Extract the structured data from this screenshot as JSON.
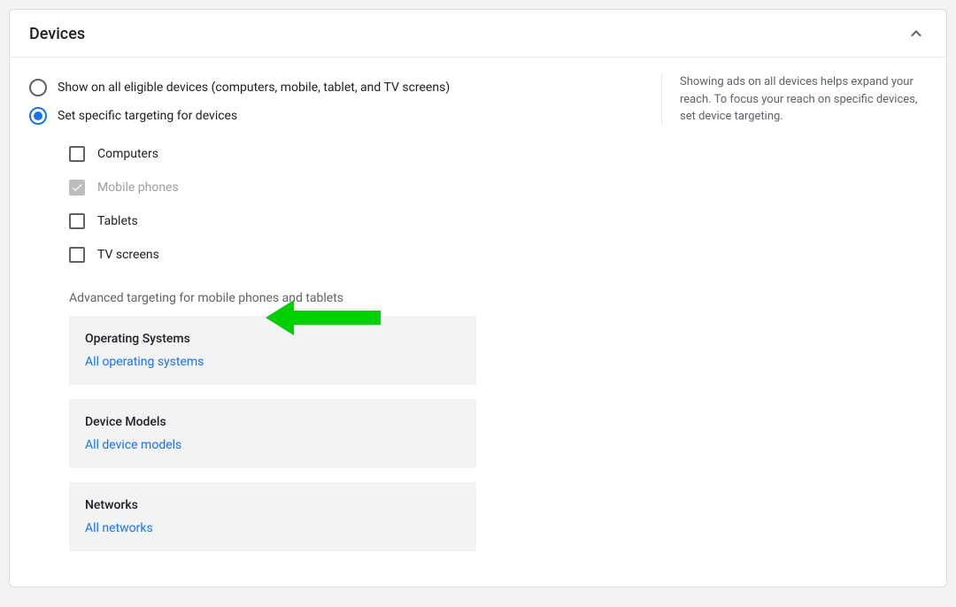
{
  "header": {
    "title": "Devices"
  },
  "radios": {
    "all": "Show on all eligible devices (computers, mobile, tablet, and TV screens)",
    "specific": "Set specific targeting for devices"
  },
  "checkboxes": {
    "computers": "Computers",
    "mobile": "Mobile phones",
    "tablets": "Tablets",
    "tv": "TV screens"
  },
  "advanced_label": "Advanced targeting for mobile phones and tablets",
  "advanced": {
    "os": {
      "title": "Operating Systems",
      "link": "All operating systems"
    },
    "models": {
      "title": "Device Models",
      "link": "All device models"
    },
    "networks": {
      "title": "Networks",
      "link": "All networks"
    }
  },
  "help_text": "Showing ads on all devices helps expand your reach. To focus your reach on specific devices, set device targeting."
}
